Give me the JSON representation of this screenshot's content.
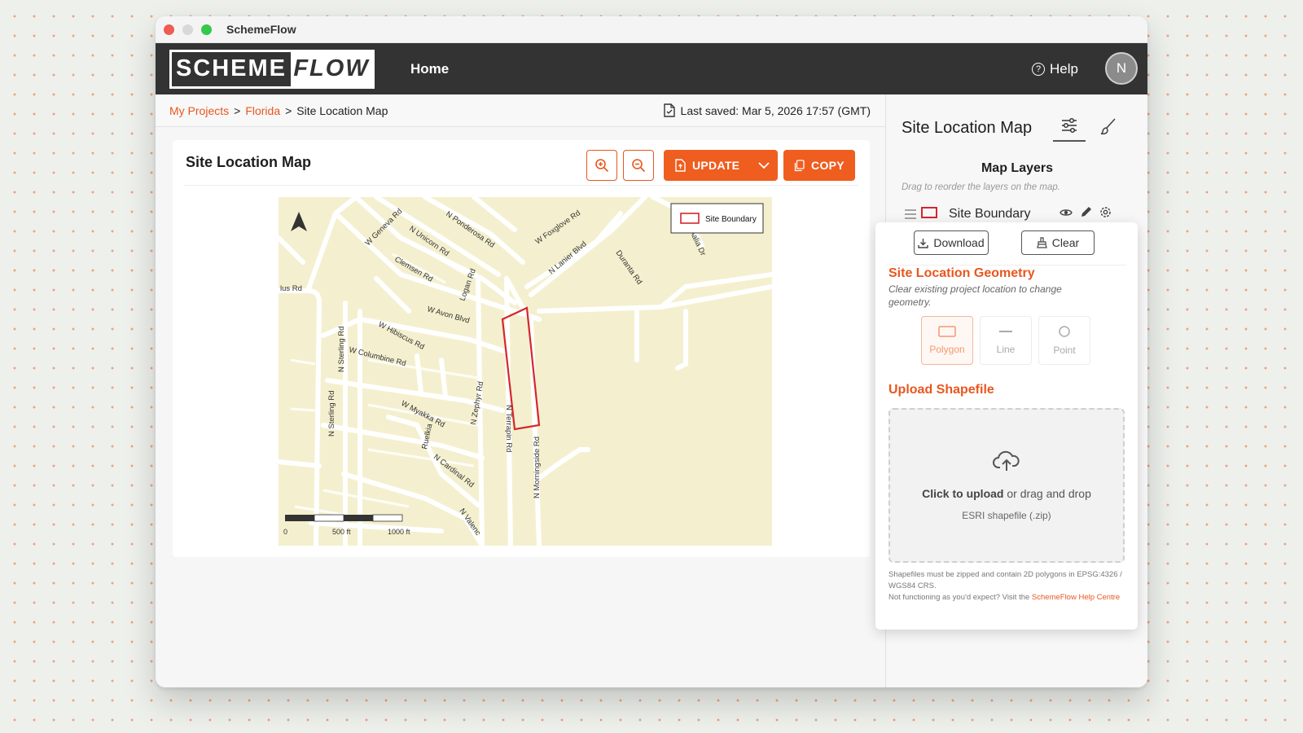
{
  "window": {
    "title": "SchemeFlow"
  },
  "topnav": {
    "logo_left": "SCHEME",
    "logo_right": "FLOW",
    "home": "Home",
    "help": "Help",
    "avatar_initial": "N"
  },
  "breadcrumb": {
    "items": [
      "My Projects",
      "Florida",
      "Site Location Map"
    ],
    "separator": ">"
  },
  "saved": {
    "text": "Last saved: Mar 5, 2026 17:57 (GMT)"
  },
  "card": {
    "title": "Site Location Map",
    "update_label": "UPDATE",
    "copy_label": "COPY"
  },
  "map": {
    "legend": "Site Boundary",
    "scale_labels": [
      "0",
      "500 ft",
      "1000 ft"
    ],
    "streets": [
      "N Ponderosa Rd",
      "W Foxglove Rd",
      "W Geneva Rd",
      "N Unicorn Rd",
      "N Lanier Blvd",
      "Duranta Rd",
      "Clemsen Rd",
      "Logan Rd",
      "W Avon Blvd",
      "W Hibiscus Rd",
      "W Columbine Rd",
      "N Sterling Rd",
      "N Zephyr Rd",
      "W Myakka Rd",
      "Ruelkia",
      "N Cardinal Rd",
      "N Terrapin Rd",
      "N Morningside Rd",
      "lus Rd",
      "N Sterling Rd",
      "N Valenc",
      "Aalia Dr"
    ]
  },
  "panel": {
    "title": "Site Location Map",
    "layers_title": "Map Layers",
    "layers_hint": "Drag to reorder the layers on the map.",
    "layer_name": "Site Boundary"
  },
  "popover": {
    "download": "Download",
    "clear": "Clear",
    "geometry_title": "Site Location Geometry",
    "geometry_desc": "Clear existing project location to change geometry.",
    "options": [
      "Polygon",
      "Line",
      "Point"
    ],
    "upload_title": "Upload Shapefile",
    "upload_main_bold": "Click to upload",
    "upload_main_rest": " or drag and drop",
    "upload_sub": "ESRI shapefile (.zip)",
    "foot1": "Shapefiles must be zipped and contain 2D polygons in EPSG:4326 / WGS84 CRS.",
    "foot2": "Not functioning as you'd expect? Visit the ",
    "foot_link": "SchemeFlow Help Centre"
  },
  "colors": {
    "accent": "#ef5d1f",
    "nav": "#333333",
    "map_bg": "#f4f0cf",
    "boundary": "#d6262f"
  }
}
